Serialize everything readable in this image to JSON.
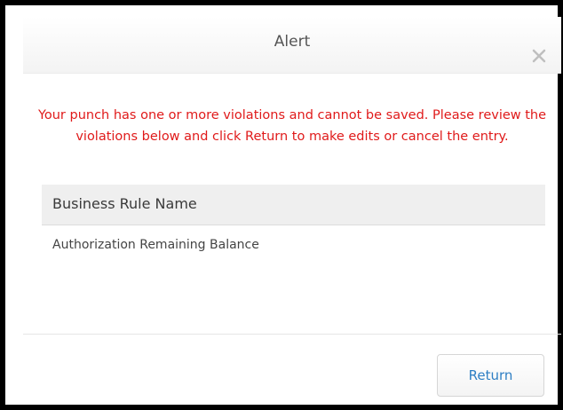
{
  "dialog": {
    "title": "Alert",
    "message": "Your punch has one or more violations and cannot be saved. Please review the violations below and click Return to make edits or cancel the entry.",
    "table": {
      "header": "Business Rule Name",
      "rows": [
        "Authorization Remaining Balance"
      ]
    },
    "return_label": "Return",
    "close_icon": "close-icon"
  },
  "colors": {
    "message_text": "#e01a1a",
    "button_text": "#2e7fc4",
    "table_header_bg": "#efefef"
  }
}
